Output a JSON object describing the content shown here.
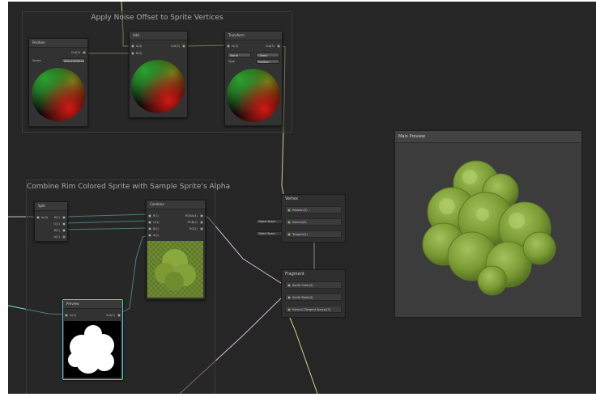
{
  "groups": {
    "noise": {
      "title": "Apply Noise Offset to Sprite Vertices"
    },
    "rim": {
      "title": "Combine Rim Colored Sprite with Sample Sprite's Alpha"
    }
  },
  "nodes": {
    "position": {
      "title": "Position",
      "out": "Out(3)",
      "space_label": "Space",
      "space_value": "AbsoluteWorld"
    },
    "add": {
      "title": "Add",
      "in_a": "A(3)",
      "in_b": "B(3)",
      "out": "Out(3)"
    },
    "transform": {
      "title": "Transform",
      "in": "In(3)",
      "out": "Out(3)",
      "from": "World",
      "to": "Object",
      "type_label": "Type",
      "type_value": "Position"
    },
    "split": {
      "title": "Split",
      "in": "In(4)",
      "outs": [
        "R(1)",
        "G(1)",
        "B(1)",
        "A(1)"
      ]
    },
    "combine": {
      "title": "Combine",
      "ins": [
        "R(1)",
        "G(1)",
        "B(1)",
        "A(1)"
      ],
      "outs": [
        "RGBA(4)",
        "RGB(3)",
        "RG(2)"
      ]
    },
    "preview": {
      "title": "Preview",
      "in": "In(1)",
      "out": "Out(1)"
    }
  },
  "vertex": {
    "title": "Vertex",
    "slots": [
      "Position(3)",
      "Normal(3)",
      "Tangent(3)"
    ],
    "tags": [
      "Object Space",
      "Object Space"
    ]
  },
  "fragment": {
    "title": "Fragment",
    "slots": [
      "Sprite Color(4)",
      "Sprite Mask(4)",
      "Normal (Tangent Space)(3)"
    ]
  },
  "main_preview": {
    "title": "Main Preview"
  },
  "colors": {
    "background": "#262626",
    "vector3_port": "#9fd35a",
    "vector4_port": "#d8b7d8",
    "vector1_port": "#7fe0e0",
    "foliage": "#7a9a34"
  }
}
